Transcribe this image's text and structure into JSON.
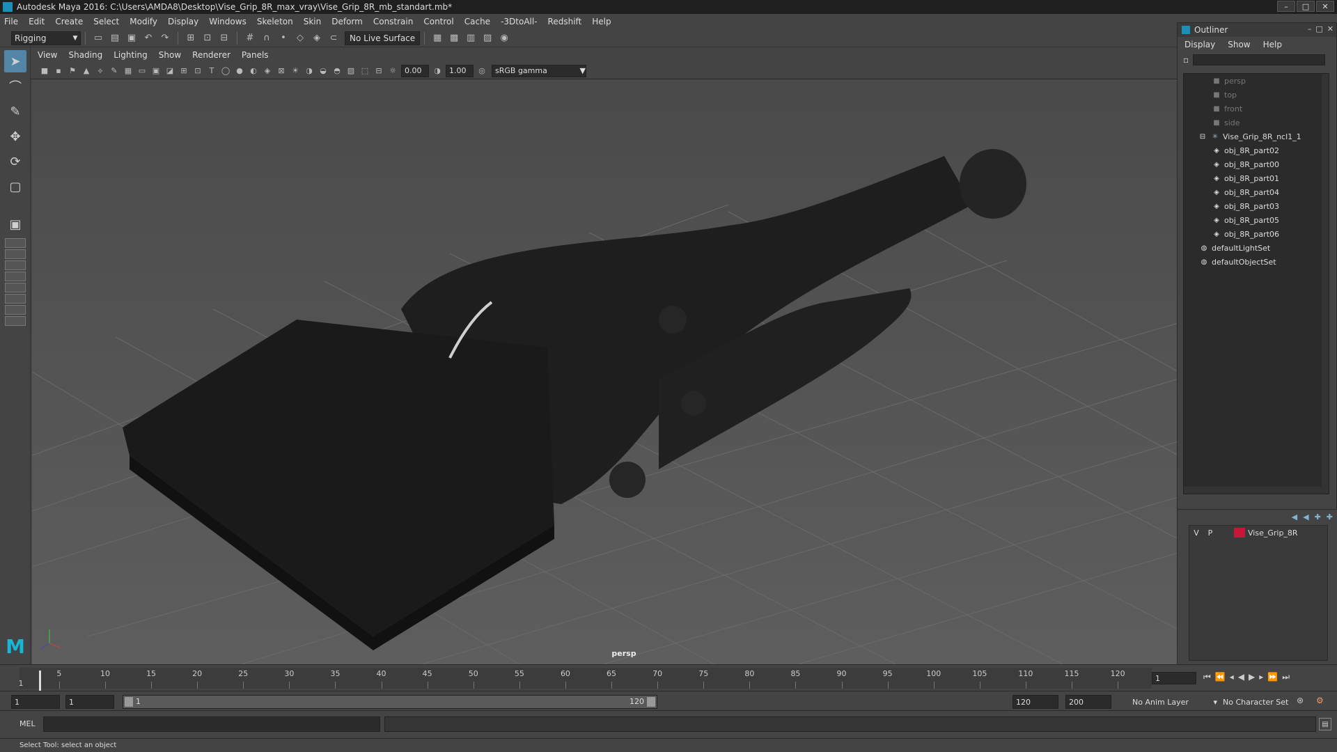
{
  "window": {
    "title": "Autodesk Maya 2016: C:\\Users\\AMDA8\\Desktop\\Vise_Grip_8R_max_vray\\Vise_Grip_8R_mb_standart.mb*"
  },
  "menu": [
    "File",
    "Edit",
    "Create",
    "Select",
    "Modify",
    "Display",
    "Windows",
    "Skeleton",
    "Skin",
    "Deform",
    "Constrain",
    "Control",
    "Cache",
    "-3DtoAll-",
    "Redshift",
    "Help"
  ],
  "shelf": {
    "mode": "Rigging",
    "live_surface": "No Live Surface"
  },
  "panel_menu": [
    "View",
    "Shading",
    "Lighting",
    "Show",
    "Renderer",
    "Panels"
  ],
  "panel_tools": {
    "exposure": "0.00",
    "gamma": "1.00",
    "color_space": "sRGB gamma"
  },
  "viewport": {
    "camera": "persp"
  },
  "outliner": {
    "title": "Outliner",
    "menu": [
      "Display",
      "Show",
      "Help"
    ],
    "cameras": [
      "persp",
      "top",
      "front",
      "side"
    ],
    "group": "Vise_Grip_8R_ncl1_1",
    "children": [
      "obj_8R_part02",
      "obj_8R_part00",
      "obj_8R_part01",
      "obj_8R_part04",
      "obj_8R_part03",
      "obj_8R_part05",
      "obj_8R_part06"
    ],
    "sets": [
      "defaultLightSet",
      "defaultObjectSet"
    ]
  },
  "layers": {
    "v": "V",
    "p": "P",
    "name": "Vise_Grip_8R",
    "color": "#c4173a"
  },
  "timeline": {
    "ticks": [
      "5",
      "10",
      "15",
      "20",
      "25",
      "30",
      "35",
      "40",
      "45",
      "50",
      "55",
      "60",
      "65",
      "70",
      "75",
      "80",
      "85",
      "90",
      "95",
      "100",
      "105",
      "110",
      "115",
      "120"
    ],
    "current_frame": "1",
    "frame_marker": "1"
  },
  "range": {
    "start": "1",
    "anim_start": "1",
    "slider_start": "1",
    "slider_end": "120",
    "anim_end": "120",
    "end": "200",
    "anim_layer": "No Anim Layer",
    "character_set": "No Character Set"
  },
  "command": {
    "label": "MEL"
  },
  "help_line": "Select Tool: select an object"
}
